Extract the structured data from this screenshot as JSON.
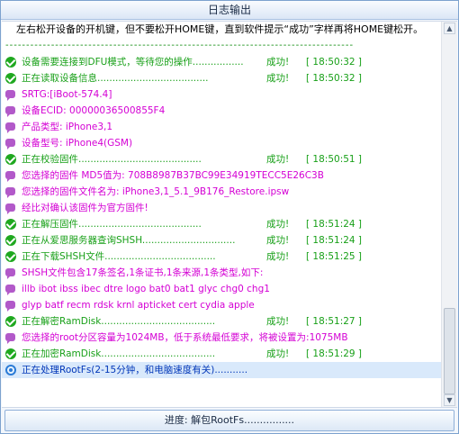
{
  "window": {
    "title": "日志输出"
  },
  "log": [
    {
      "type": "plain",
      "text": "左右松开设备的开机键，但不要松开HOME键，直到软件提示“成功”字样再将HOME键松开。"
    },
    {
      "type": "sep",
      "text": "------------------------------------------------------------------------------------"
    },
    {
      "type": "ok",
      "text": "设备需要连接到DFU模式，等待您的操作.................",
      "status": "成功!",
      "time": "[ 18:50:32 ]"
    },
    {
      "type": "ok",
      "text": "正在读取设备信息.....................................",
      "status": "成功!",
      "time": "[ 18:50:32 ]"
    },
    {
      "type": "msg",
      "text": "SRTG:[iBoot-574.4]"
    },
    {
      "type": "msg",
      "text": "设备ECID: 000000365008​55F4"
    },
    {
      "type": "msg",
      "text": "产品类型: iPhone3,1"
    },
    {
      "type": "msg",
      "text": "设备型号: iPhone4(GSM)"
    },
    {
      "type": "ok",
      "text": "正在校验固件.........................................",
      "status": "成功!",
      "time": "[ 18:50:51 ]"
    },
    {
      "type": "msg",
      "text": "您选择的固件 MD5值为: 708B8987B37BC99E34919TECC5E26C3B"
    },
    {
      "type": "msg",
      "text": "您选择的固件文件名为: iPhone3,1_5.1_9B176_Restore.ipsw"
    },
    {
      "type": "msg",
      "text": "经比对确认该固件为官方固件!"
    },
    {
      "type": "ok",
      "text": "正在解压固件.........................................",
      "status": "成功!",
      "time": "[ 18:51:24 ]"
    },
    {
      "type": "ok",
      "text": "正在从爱思服务器查询SHSH...............................",
      "status": "成功!",
      "time": "[ 18:51:24 ]"
    },
    {
      "type": "ok",
      "text": "正在下载SHSH文件.....................................",
      "status": "成功!",
      "time": "[ 18:51:25 ]"
    },
    {
      "type": "msg",
      "text": "SHSH文件包含17条签名,1条证书,1条来源,1条类型,如下:"
    },
    {
      "type": "msg",
      "text": "illb ibot ibss ibec dtre logo bat0 bat1 glyc chg0 chg1"
    },
    {
      "type": "msg",
      "text": "glyp batf recm rdsk krnl apticket cert cydia apple"
    },
    {
      "type": "ok",
      "text": "正在解密RamDisk......................................",
      "status": "成功!",
      "time": "[ 18:51:27 ]"
    },
    {
      "type": "msg",
      "text": "您选择的root分区容量为1024MB，低于系统最低要求，将被设置为:1075MB"
    },
    {
      "type": "ok",
      "text": "正在加密RamDisk......................................",
      "status": "成功!",
      "time": "[ 18:51:29 ]"
    },
    {
      "type": "busy",
      "text": "正在处理RootFs(2-15分钟，和电脑速度有关)..........."
    }
  ],
  "progress": {
    "label": "进度:  解包RootFs................"
  }
}
